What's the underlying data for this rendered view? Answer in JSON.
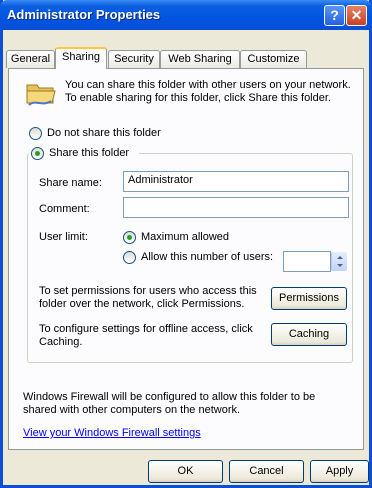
{
  "window": {
    "title": "Administrator Properties",
    "help_glyph": "?",
    "close_glyph": "✕"
  },
  "tabs": [
    {
      "label": "General"
    },
    {
      "label": "Sharing"
    },
    {
      "label": "Security"
    },
    {
      "label": "Web Sharing"
    },
    {
      "label": "Customize"
    }
  ],
  "sharing": {
    "intro": "You can share this folder with other users on your network.  To enable sharing for this folder, click Share this folder.",
    "do_not_share_label": "Do not share this folder",
    "share_label": "Share this folder",
    "share_name_label": "Share name:",
    "share_name_value": "Administrator",
    "comment_label": "Comment:",
    "comment_value": "",
    "user_limit_label": "User limit:",
    "max_allowed_label": "Maximum allowed",
    "allow_number_label": "Allow this number of users:",
    "user_count_value": "",
    "permissions_text": "To set permissions for users who access this folder over the network, click Permissions.",
    "permissions_button": "Permissions",
    "caching_text": "To configure settings for offline access, click Caching.",
    "caching_button": "Caching",
    "firewall_text": "Windows Firewall will be configured to allow this folder to be shared with other computers on the network.",
    "firewall_link": "View your Windows Firewall settings"
  },
  "buttons": {
    "ok": "OK",
    "cancel": "Cancel",
    "apply": "Apply"
  },
  "colors": {
    "titlebar": "#0054e3",
    "window_bg": "#ece9d8",
    "panel_bg": "#fcfcfe",
    "active_tab_accent": "#ffc83c",
    "link": "#0000ff"
  }
}
